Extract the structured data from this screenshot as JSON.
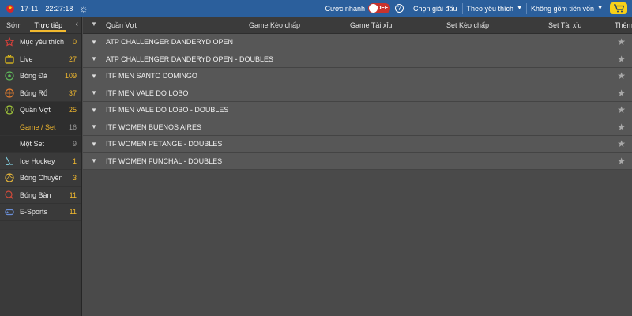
{
  "topbar": {
    "date": "17-11",
    "time": "22:27:18",
    "quick_bet_label": "Cược nhanh",
    "quick_bet_toggle": "OFF",
    "help": "?",
    "choose_league": "Chọn giải đấu",
    "sort_by": "Theo yêu thích",
    "odds_filter": "Không gồm tiền vốn",
    "cart_icon": "cart-icon"
  },
  "sidebar": {
    "tabs": [
      {
        "label": "Sớm"
      },
      {
        "label": "Trực tiếp"
      }
    ],
    "items": [
      {
        "label": "Mục yêu thích",
        "count": "0",
        "icon": "star-icon"
      },
      {
        "label": "Live",
        "count": "27",
        "icon": "tv-icon"
      },
      {
        "label": "Bóng Đá",
        "count": "109",
        "icon": "soccer-icon"
      },
      {
        "label": "Bóng Rổ",
        "count": "37",
        "icon": "basketball-icon"
      },
      {
        "label": "Quần Vợt",
        "count": "25",
        "icon": "tennis-icon"
      }
    ],
    "sub_items": [
      {
        "label": "Game / Set",
        "count": "16"
      },
      {
        "label": "Một Set",
        "count": "9"
      }
    ],
    "items2": [
      {
        "label": "Ice Hockey",
        "count": "1",
        "icon": "hockey-icon"
      },
      {
        "label": "Bóng Chuyền",
        "count": "3",
        "icon": "volleyball-icon"
      },
      {
        "label": "Bóng Bàn",
        "count": "11",
        "icon": "table-tennis-icon"
      },
      {
        "label": "E-Sports",
        "count": "11",
        "icon": "gamepad-icon"
      }
    ]
  },
  "table": {
    "headers": {
      "sport": "Quần Vợt",
      "game_handicap": "Game Kèo chấp",
      "game_total": "Game Tài xỉu",
      "set_handicap": "Set Kèo chấp",
      "set_total": "Set Tài xỉu",
      "more": "Thêm"
    },
    "leagues": [
      "ATP CHALLENGER DANDERYD OPEN",
      "ATP CHALLENGER DANDERYD OPEN - DOUBLES",
      "ITF MEN SANTO DOMINGO",
      "ITF MEN VALE DO LOBO",
      "ITF MEN VALE DO LOBO - DOUBLES",
      "ITF WOMEN BUENOS AIRES",
      "ITF WOMEN PETANGE - DOUBLES",
      "ITF WOMEN FUNCHAL - DOUBLES"
    ]
  },
  "colors": {
    "topbar": "#2b5f9c",
    "accent": "#f2b92e",
    "toggle_off": "#c8332d",
    "cart": "#f7d018"
  }
}
